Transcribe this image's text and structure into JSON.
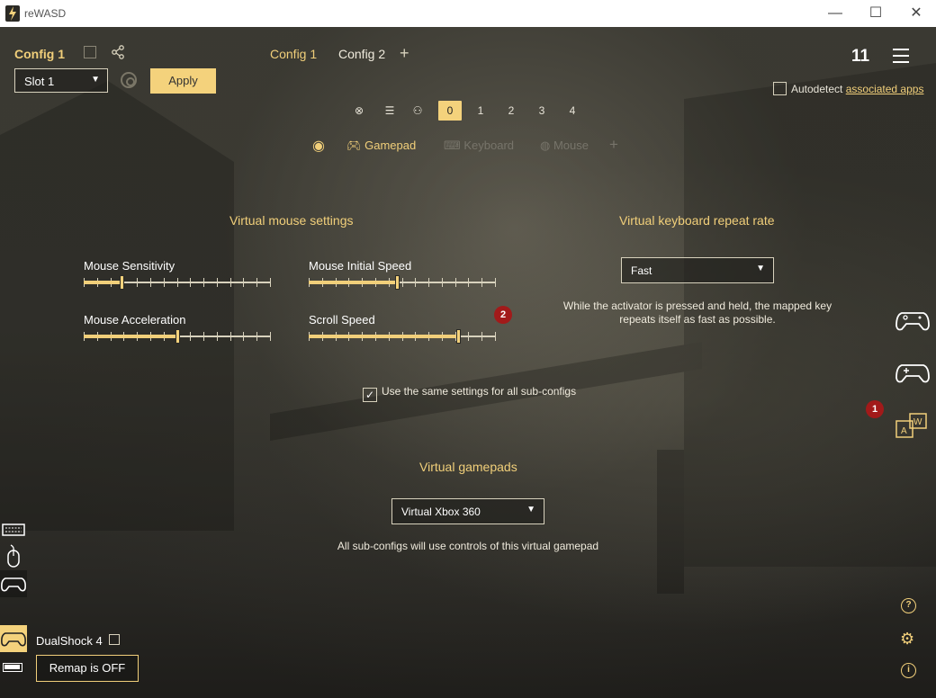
{
  "window": {
    "title": "reWASD",
    "minimize": "—",
    "maximize": "☐",
    "close": "✕"
  },
  "header": {
    "config_title": "Config 1",
    "slot_value": "Slot 1",
    "apply_label": "Apply",
    "tabs": [
      {
        "label": "Config 1"
      },
      {
        "label": "Config 2"
      }
    ],
    "tab_add": "+",
    "count": "11",
    "autodetect_label": "Autodetect",
    "autodetect_link": "associated apps"
  },
  "mode_icons": [
    "xbox-icon",
    "list-icon",
    "shift-icon",
    "shift-0-icon",
    "shift-1-icon",
    "shift-2-icon",
    "shift-3-icon",
    "shift-4-icon"
  ],
  "mode_labels": [
    "⊗",
    "☰",
    "⚇",
    "0",
    "1",
    "2",
    "3",
    "4"
  ],
  "subtabs": {
    "gamepad": "Gamepad",
    "keyboard": "Keyboard",
    "mouse": "Mouse",
    "add": "+"
  },
  "mouse_settings": {
    "title": "Virtual mouse settings",
    "sliders": [
      {
        "label": "Mouse Sensitivity",
        "value": 0.2
      },
      {
        "label": "Mouse Initial Speed",
        "value": 0.47
      },
      {
        "label": "Mouse Acceleration",
        "value": 0.5
      },
      {
        "label": "Scroll Speed",
        "value": 0.8
      }
    ]
  },
  "keyboard_repeat": {
    "title": "Virtual keyboard repeat rate",
    "value": "Fast",
    "description": "While the activator is pressed and held, the mapped key repeats itself as fast as possible."
  },
  "badges": {
    "scroll_badge": "2",
    "right_badge": "1"
  },
  "same_settings": {
    "checked": "✓",
    "label": "Use the same settings for all sub-configs"
  },
  "virtual_gamepads": {
    "title": "Virtual gamepads",
    "value": "Virtual Xbox 360",
    "description": "All sub-configs will use controls of this virtual gamepad"
  },
  "device": {
    "name": "DualShock 4",
    "remap_label": "Remap is OFF"
  },
  "help": {
    "question": "?",
    "info": "i",
    "gear": "⚙"
  },
  "colors": {
    "accent": "#f1cf7a",
    "apply_bg": "#f4d27c",
    "badge_red": "#a21a1a"
  }
}
